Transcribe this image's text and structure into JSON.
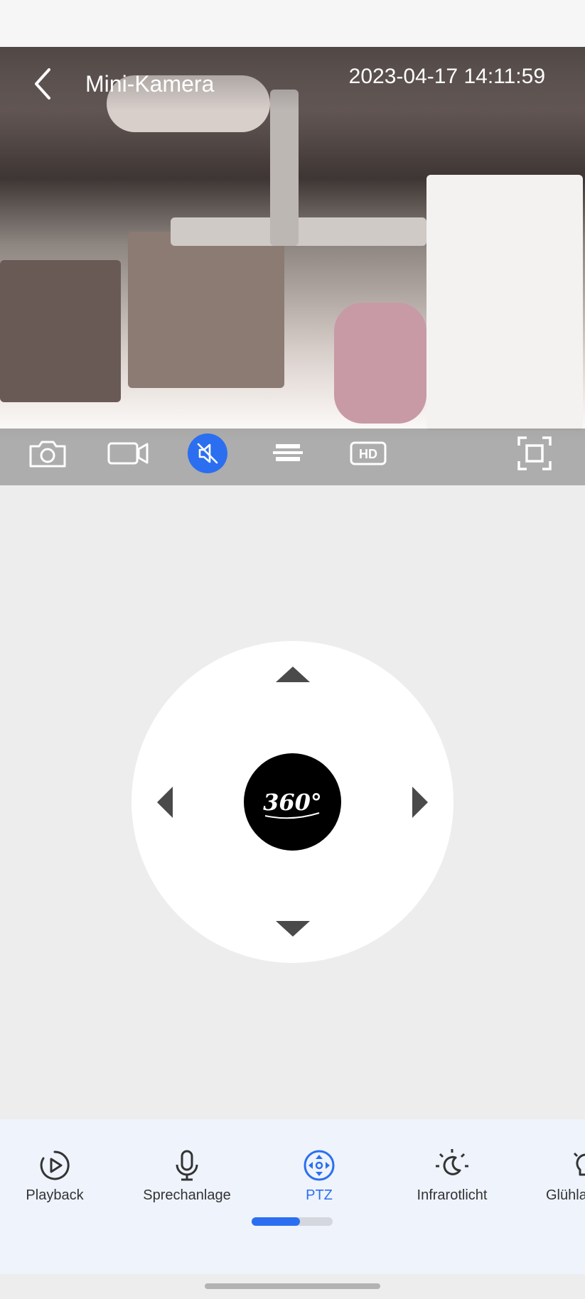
{
  "header": {
    "back_icon": "chevron-left-icon",
    "title": "Mini-Kamera",
    "timestamp": "2023-04-17 14:11:59"
  },
  "video_toolbar": {
    "items": [
      {
        "icon": "camera-icon",
        "name": "snapshot"
      },
      {
        "icon": "video-record-icon",
        "name": "record"
      },
      {
        "icon": "mute-icon",
        "name": "mute",
        "active": true
      },
      {
        "icon": "flip-icon",
        "name": "flip"
      },
      {
        "icon": "hd-icon",
        "name": "quality",
        "label": "HD"
      },
      {
        "icon": "fullscreen-icon",
        "name": "fullscreen"
      }
    ]
  },
  "ptz": {
    "center_label": "360°"
  },
  "function_bar": {
    "items": [
      {
        "label": "Playback",
        "icon": "playback-icon"
      },
      {
        "label": "Sprechanlage",
        "icon": "microphone-icon"
      },
      {
        "label": "PTZ",
        "icon": "ptz-icon",
        "active": true
      },
      {
        "label": "Infrarotlicht",
        "icon": "night-light-icon"
      },
      {
        "label": "Glühla",
        "icon": "bulb-icon"
      }
    ],
    "page_progress": 0.6
  },
  "colors": {
    "accent": "#2b6ff0",
    "background": "#ededed",
    "function_bar_bg": "#eef3fc"
  }
}
